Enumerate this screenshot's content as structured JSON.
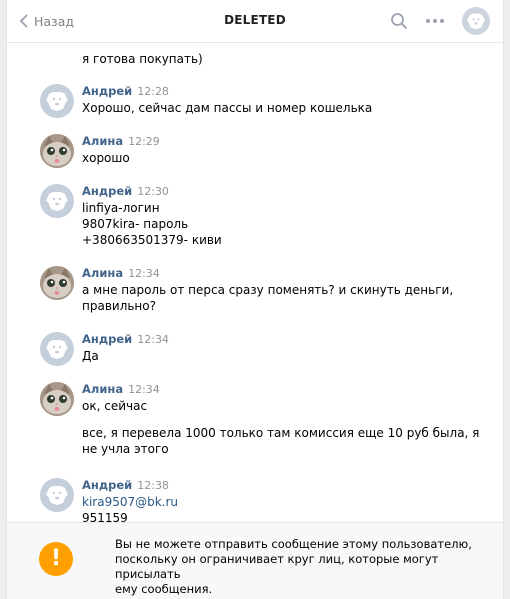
{
  "header": {
    "back_label": "Назад",
    "title": "DELETED"
  },
  "messages": [
    {
      "id": 0,
      "text": [
        "я готова покупать)"
      ]
    },
    {
      "id": 1,
      "author": "Андрей",
      "time": "12:28",
      "avatar": "dog-avatar",
      "text": [
        "Хорошо, сейчас дам пассы и номер кошелька"
      ]
    },
    {
      "id": 2,
      "author": "Алина",
      "time": "12:29",
      "avatar": "cat-avatar",
      "text": [
        "хорошо"
      ]
    },
    {
      "id": 3,
      "author": "Андрей",
      "time": "12:30",
      "avatar": "dog-avatar",
      "text": [
        "linfiya-логин",
        "9807kira- пароль",
        "+380663501379- киви"
      ]
    },
    {
      "id": 4,
      "author": "Алина",
      "time": "12:34",
      "avatar": "cat-avatar",
      "text": [
        "а мне пароль от перса сразу поменять? и скинуть деньги,",
        "правильно?"
      ]
    },
    {
      "id": 5,
      "author": "Андрей",
      "time": "12:34",
      "avatar": "dog-avatar",
      "text": [
        "Да"
      ]
    },
    {
      "id": 6,
      "author": "Алина",
      "time": "12:34",
      "avatar": "cat-avatar",
      "text": [
        "ок, сейчас",
        "все, я перевела 1000 только там комиссия еще 10 руб была, я",
        "не учла этого"
      ]
    },
    {
      "id": 7,
      "author": "Андрей",
      "time": "12:38",
      "avatar": "dog-avatar",
      "text": [
        "kira9507@bk.ru",
        "951159"
      ]
    }
  ],
  "footer": {
    "icon": "exclamation-icon",
    "text": [
      "Вы не можете отправить сообщение этому пользователю,",
      "поскольку он ограничивает круг лиц, которые могут присылать",
      "ему сообщения."
    ]
  },
  "colors": {
    "author": "#42648b",
    "link": "#2a5885",
    "warning": "#ffa000"
  }
}
